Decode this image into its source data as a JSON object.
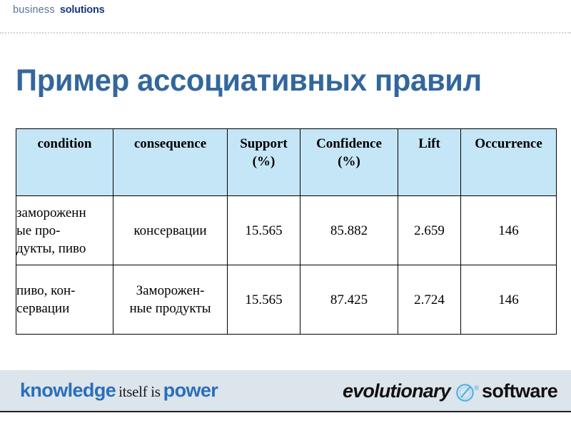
{
  "header": {
    "logo_light": "business",
    "logo_bold": "solutions",
    "divider": "dashed-rule"
  },
  "title": "Пример ассоциативных правил",
  "colors": {
    "title_blue": "#33679c",
    "table_header_bg": "#c5e6f7",
    "footer_bg": "#dce4ec",
    "brand_navy": "#17397a",
    "brand_gray_blue": "#5a7494",
    "knowledge_blue": "#2a6fb8",
    "logo_mark_blue": "#3fa9dd"
  },
  "table": {
    "columns": [
      "condition",
      "consequence",
      "Support (%)",
      "Confidence (%)",
      "Lift",
      "Occurrence"
    ],
    "headers": {
      "condition": "condition",
      "consequence": "consequence",
      "support_line1": "Support",
      "support_line2": "(%)",
      "confidence_line1": "Confidence",
      "confidence_line2": "(%)",
      "lift": "Lift",
      "occurrence": "Occurrence"
    },
    "rows": [
      {
        "condition_line1": "замороженн",
        "condition_line2": "ые про-",
        "condition_line3": "дукты, пиво",
        "consequence": "консервации",
        "support": "15.565",
        "confidence": "85.882",
        "lift": "2.659",
        "occurrence": "146"
      },
      {
        "condition_line1": "пиво, кон-",
        "condition_line2": "сервации",
        "condition_line3": "",
        "consequence_line1": "Заморожен-",
        "consequence_line2": "ные продукты",
        "support": "15.565",
        "confidence": "87.425",
        "lift": "2.724",
        "occurrence": "146"
      }
    ]
  },
  "footer": {
    "left": {
      "word1": "knowledge",
      "word2": "itself is",
      "word3": "power"
    },
    "right": {
      "word1": "evolutionary",
      "mark": "e-circle-logo",
      "registered": "®",
      "word2": "software"
    }
  }
}
